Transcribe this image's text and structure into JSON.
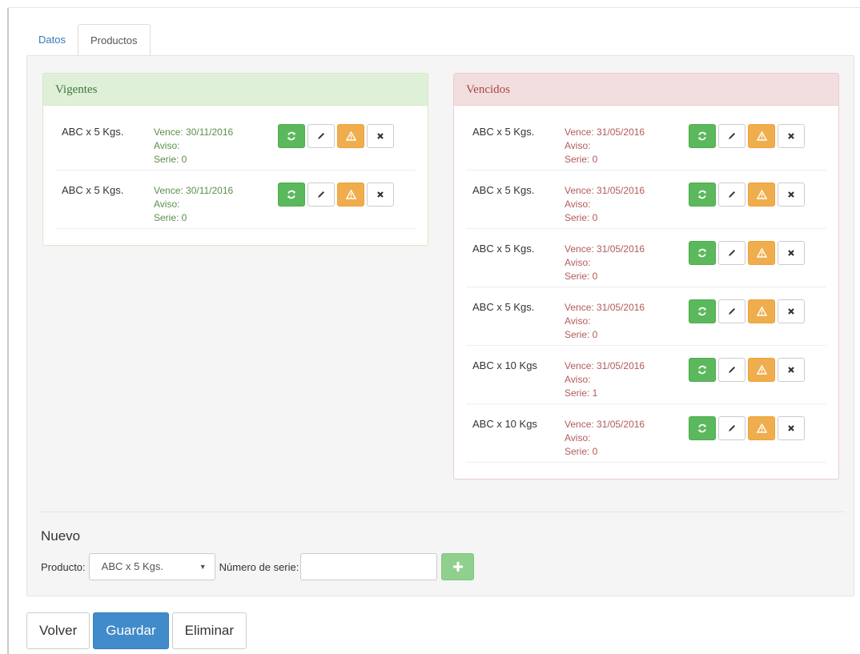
{
  "tabs": [
    {
      "label": "Datos",
      "active": true
    },
    {
      "label": "Productos",
      "active": false
    }
  ],
  "vigentes": {
    "title": "Vigentes",
    "items": [
      {
        "product": "ABC x 5 Kgs.",
        "vence": "Vence: 30/11/2016",
        "aviso": "Aviso:",
        "serie": "Serie: 0"
      },
      {
        "product": "ABC x 5 Kgs.",
        "vence": "Vence: 30/11/2016",
        "aviso": "Aviso:",
        "serie": "Serie: 0"
      }
    ]
  },
  "vencidos": {
    "title": "Vencidos",
    "items": [
      {
        "product": "ABC x 5 Kgs.",
        "vence": "Vence: 31/05/2016",
        "aviso": "Aviso:",
        "serie": "Serie: 0"
      },
      {
        "product": "ABC x 5 Kgs.",
        "vence": "Vence: 31/05/2016",
        "aviso": "Aviso:",
        "serie": "Serie: 0"
      },
      {
        "product": "ABC x 5 Kgs.",
        "vence": "Vence: 31/05/2016",
        "aviso": "Aviso:",
        "serie": "Serie: 0"
      },
      {
        "product": "ABC x 5 Kgs.",
        "vence": "Vence: 31/05/2016",
        "aviso": "Aviso:",
        "serie": "Serie: 0"
      },
      {
        "product": "ABC x 10 Kgs",
        "vence": "Vence: 31/05/2016",
        "aviso": "Aviso:",
        "serie": "Serie: 1"
      },
      {
        "product": "ABC x 10 Kgs",
        "vence": "Vence: 31/05/2016",
        "aviso": "Aviso:",
        "serie": "Serie: 0"
      }
    ]
  },
  "row_actions": [
    {
      "icon": "refresh-icon",
      "style": "green"
    },
    {
      "icon": "pencil-icon",
      "style": "default"
    },
    {
      "icon": "warning-icon",
      "style": "orange"
    },
    {
      "icon": "close-icon",
      "style": "default"
    }
  ],
  "nuevo": {
    "title": "Nuevo",
    "producto_label": "Producto:",
    "producto_value": "ABC x 5 Kgs.",
    "serie_label": "Número de serie:",
    "serie_value": "",
    "add_icon": "plus-icon"
  },
  "actions": {
    "volver": "Volver",
    "guardar": "Guardar",
    "eliminar": "Eliminar"
  },
  "colors": {
    "success_bg": "#dff0d8",
    "danger_bg": "#f2dede",
    "btn_green": "#5cb85c",
    "btn_orange": "#f0ad4e",
    "primary": "#428bca"
  }
}
